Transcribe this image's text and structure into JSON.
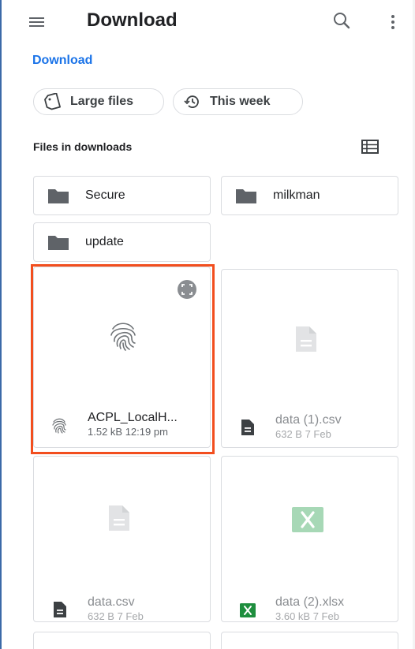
{
  "app": {
    "title": "Download"
  },
  "breadcrumb": {
    "label": "Download"
  },
  "chips": {
    "large_files": "Large files",
    "this_week": "This week"
  },
  "section": {
    "header": "Files in downloads"
  },
  "folders": [
    {
      "name": "Secure"
    },
    {
      "name": "milkman"
    },
    {
      "name": "update"
    }
  ],
  "files": [
    {
      "name": "ACPL_LocalH...",
      "meta": "1.52 kB 12:19 pm",
      "icon": "fingerprint-icon",
      "selected": true
    },
    {
      "name": "data (1).csv",
      "meta": "632 B 7 Feb",
      "icon": "document-icon"
    },
    {
      "name": "data.csv",
      "meta": "632 B 7 Feb",
      "icon": "document-icon"
    },
    {
      "name": "data (2).xlsx",
      "meta": "3.60 kB 7 Feb",
      "icon": "excel-icon"
    }
  ],
  "colors": {
    "accent": "#1a73e8",
    "selection": "#f24e1e",
    "excel": "#1e8e3e"
  }
}
